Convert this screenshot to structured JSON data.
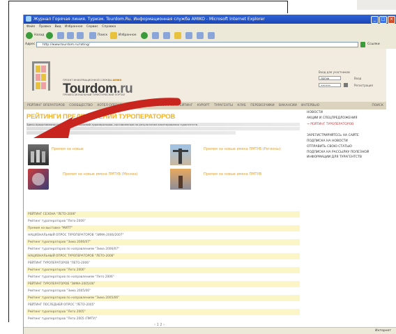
{
  "window": {
    "title": "Журнал Горячая линия. Туризм. Tourdom.Ru. Информационная служба AMIKO - Microsoft Internet Explorer",
    "controls": {
      "minimize": "_",
      "maximize": "□",
      "close": "×"
    }
  },
  "menubar": {
    "items": [
      "Файл",
      "Правка",
      "Вид",
      "Избранное",
      "Сервис",
      "Справка"
    ]
  },
  "toolbar": {
    "back_label": "Назад",
    "search_label": "Поиск",
    "favorites_label": "Избранное"
  },
  "addressbar": {
    "label": "Адрес",
    "url": "http://www.tourdom.ru/rating/",
    "links_label": "Ссылки"
  },
  "site": {
    "brand": "Tourdom",
    "brand_suffix": ".ru",
    "tagline_top": "ПРОЕКТ ИНФОРМАЦИОННОЙ СЛУЖБЫ",
    "tagline_top_brand": "AMIKO",
    "tagline_bottom": "ПРОФЕССИОНАЛЬНЫЙ ТУРИСТИЧЕСКИЙ ПОРТАЛ",
    "login": {
      "label": "Вход для участников",
      "username_value": "логин",
      "password_value": "••••••",
      "side_line1": "Вход",
      "side_line2": "Регистрация"
    },
    "nav": {
      "items": [
        "РЕЙТИНГ ОПЕРАТОРОВ",
        "СООБЩЕСТВО",
        "ХОТЕЛ ОПЕРАТОРЫ",
        "КАЛЕНДАРЬ",
        "НОВОСТИ",
        "РЕЙТИНГ",
        "КУРОРТ",
        "ТУРАГЕНТЫ",
        "КЛУБ",
        "ПЕРЕВОЗЧИКИ",
        "ВАКАНСИИ",
        "ИНТЕРВЬЮ"
      ],
      "search": "ПОИСК"
    },
    "page_title": "РЕЙТИНГИ ПРЕДПОЧТЕНИЙ ТУРОПЕРАТОРОВ",
    "lead_text": "Здесь представлены рейтинги предпочтений туроператоров, составленные по результатам анкетирования турагентств.",
    "thumbs": [
      {
        "caption": "Премия на новые"
      },
      {
        "caption": "Премия на новые имена ПМТУВ (Регионы)"
      },
      {
        "caption": "Премия на новые имена ПМТУВ (Москва)"
      },
      {
        "caption": "Премия на новые имена ПМТУВ"
      }
    ],
    "sidebar": {
      "items": [
        {
          "label": "НОВОСТИ",
          "accent": false
        },
        {
          "label": "АКЦИИ И СПЕЦПРЕДЛОЖЕНИЯ",
          "accent": false
        },
        {
          "label": "→ РЕЙТИНГ ТУРОПЕРАТОРОВ",
          "accent": true
        },
        {
          "label": "ЗАРЕГИСТРИРУЙТЕСЬ НА САЙТЕ",
          "accent": false
        },
        {
          "label": "ПОДПИСКА НА НОВОСТИ",
          "accent": false
        },
        {
          "label": "ОТПРАВИТЬ СВОЮ СТАТЬЮ",
          "accent": false
        },
        {
          "label": "ПОДПИСКА НА РАССЫЛКУ ПОЛЕЗНОЙ",
          "accent": false
        },
        {
          "label": "ИНФОРМАЦИИ ДЛЯ ТУРАГЕНТСТВ",
          "accent": false
        }
      ]
    },
    "ratings": [
      "РЕЙТИНГ СЕЗОНА \"ЛЕТО-2006\"",
      "Рейтинг туроператоров \"Лето-2006\"",
      "Премия на выставке \"МИТТ\"",
      "НАЦИОНАЛЬНЫЙ ОПРОС ТУРОПЕРАТОРОВ \"ЗИМА-2006/2007\"",
      "Рейтинг туроператоров \"Зима 2006/07\"",
      "Рейтинг туроператоров по направлениям \"Зима 2006/07\"",
      "НАЦИОНАЛЬНЫЙ ОПРОС ТУРОПЕРАТОРОВ \"ЛЕТО-2006\"",
      "РЕЙТИНГ ТУРОПЕРАТОРОВ \"ЛЕТО-2006\"",
      "Рейтинг туроператоров \"Лето 2006\"",
      "Рейтинг туроператоров по направлениям \"Лето 2006\"",
      "РЕЙТИНГ ТУРОПЕРАТОРОВ \"ЗИМА-2005/06\"",
      "Рейтинг туроператоров \"Зима 2005/06\"",
      "Рейтинг туроператоров по направлениям \"Зима 2005/06\"",
      "РЕЙТИНГ ПОСЛЕДНЕЙ ОПРОС \"ЛЕТО-2005\"",
      "Рейтинг туроператоров \"Лето 2005\"",
      "Рейтинг туроператоров \"Лето 2005 (ПМТУ)\""
    ],
    "pager": "‹  1  2  ›"
  },
  "statusbar": {
    "zone": "Интернет"
  },
  "colors": {
    "accent": "#f0b32c",
    "highlight_row": "#fcf5c6",
    "nav_bg": "#dcd3bf",
    "arrow": "#c8251f"
  }
}
